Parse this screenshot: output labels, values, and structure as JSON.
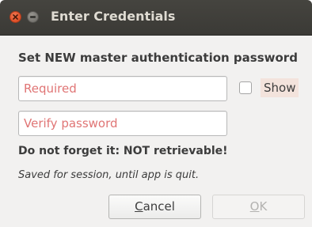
{
  "window": {
    "title": "Enter Credentials"
  },
  "form": {
    "heading": "Set NEW master authentication password",
    "password_placeholder": "Required",
    "verify_placeholder": "Verify password",
    "show_label": "Show",
    "show_checked": false,
    "warning": "Do not forget it:  NOT retrievable!",
    "note": "Saved for session, until app is quit."
  },
  "buttons": {
    "cancel": {
      "mnemonic": "C",
      "rest": "ancel",
      "enabled": true
    },
    "ok": {
      "mnemonic": "O",
      "rest": "K",
      "enabled": false
    }
  },
  "colors": {
    "titlebar": "#3c3b37",
    "placeholder": "#e07575",
    "close_button": "#e2542c"
  },
  "icons": [
    "close-icon",
    "minimize-icon"
  ]
}
